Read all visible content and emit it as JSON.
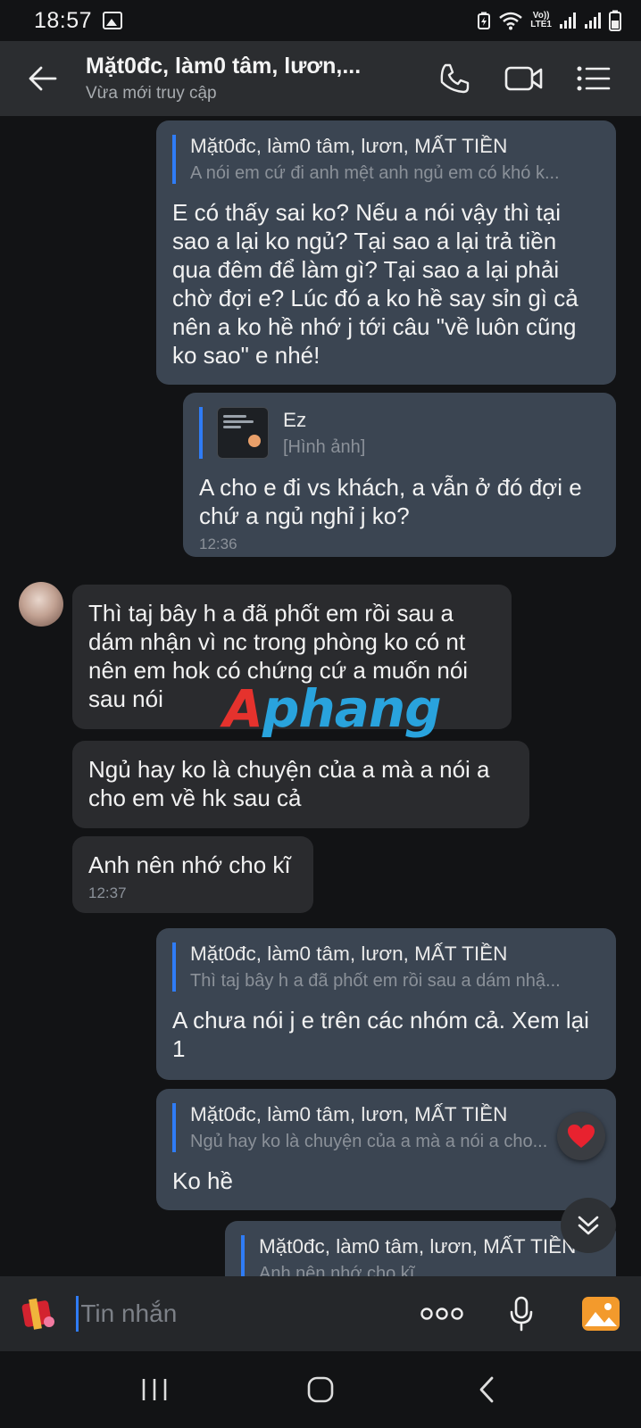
{
  "status_bar": {
    "time": "18:57",
    "volte_top": "Vo))",
    "volte_bottom": "LTE1"
  },
  "header": {
    "title": "Mặt0đc, làm0 tâm, lươn,...",
    "subtitle": "Vừa mới truy cập",
    "icons": [
      "back-arrow-icon",
      "phone-icon",
      "video-call-icon",
      "menu-list-icon"
    ]
  },
  "messages": [
    {
      "quote_name": "Mặt0đc, làm0 tâm, lươn, MẤT TIỀN",
      "quote_text": "A nói em cứ đi anh mệt anh ngủ em có khó k...",
      "text": "E có thấy sai ko? Nếu a nói vậy thì tại sao a lại ko ngủ? Tại sao a lại trả tiền qua đêm để làm gì? Tại sao a lại phải chờ đợi e? Lúc đó a ko hề say sỉn gì cả nên a ko hề nhớ j tới câu \"về luôn cũng ko sao\" e nhé!"
    },
    {
      "quote_name": "Ez",
      "quote_text": "[Hình ảnh]",
      "text": "A cho e đi vs khách, a vẫn ở đó đợi e chứ a ngủ nghỉ j ko?",
      "time": "12:36"
    },
    {
      "text": "Thì taj bây h a đã phốt em rồi sau a dám nhận vì nc trong phòng ko có nt nên em hok có chứng cứ a muốn nói sau nói"
    },
    {
      "text": "Ngủ hay ko là chuyện của a mà a nói a cho em về hk sau cả"
    },
    {
      "text": "Anh nên nhớ cho kĩ",
      "time": "12:37"
    },
    {
      "quote_name": "Mặt0đc, làm0 tâm, lươn, MẤT TIỀN",
      "quote_text": "Thì taj bây h a đã phốt em rồi sau a dám nhậ...",
      "text": "A chưa nói j e trên các nhóm cả. Xem lại 1"
    },
    {
      "quote_name": "Mặt0đc, làm0 tâm, lươn, MẤT TIỀN",
      "quote_text": "Ngủ hay ko là chuyện của a mà a nói a cho...",
      "text": "Ko hề"
    },
    {
      "quote_name": "Mặt0đc, làm0 tâm, lươn, MẤT TIỀN",
      "quote_text": "Anh nên nhớ cho kĩ"
    }
  ],
  "watermark": {
    "part_a": "A",
    "part_b": "phang"
  },
  "input": {
    "placeholder": "Tin nhắn"
  },
  "colors": {
    "sent_bubble": "#3b4552",
    "received_bubble": "#2a2b2e",
    "accent": "#2f7cf6",
    "background": "#121315"
  }
}
